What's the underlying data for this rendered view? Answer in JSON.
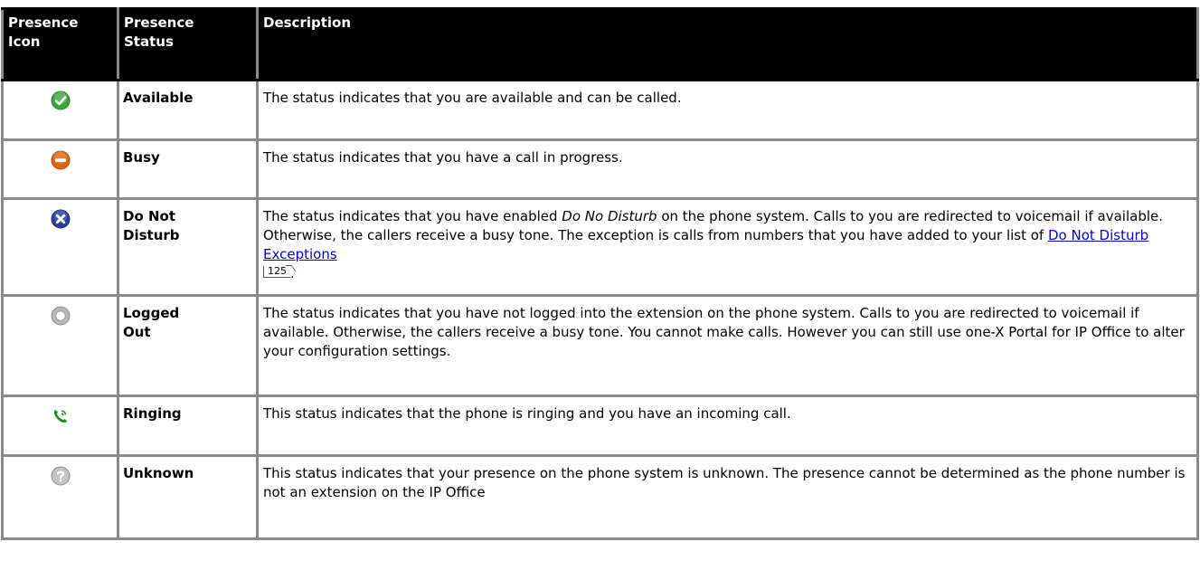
{
  "table": {
    "headers": {
      "icon": [
        "Presence",
        "Icon"
      ],
      "status": [
        "Presence",
        "Status"
      ],
      "description": "Description"
    },
    "rows": [
      {
        "icon": "check-circle-icon",
        "icon_color": "#3aa635",
        "status": "Available",
        "description": "The status indicates that you are available and can be called."
      },
      {
        "icon": "minus-circle-icon",
        "icon_color": "#e0640f",
        "status": "Busy",
        "description": "The status indicates that you have a call in progress."
      },
      {
        "icon": "x-circle-icon",
        "icon_color": "#2a3fa0",
        "status_lines": [
          "Do Not",
          "Disturb"
        ],
        "description_parts": {
          "before_italic": "The status indicates that you have enabled ",
          "italic": "Do No Disturb",
          "after_italic": " on the phone system. Calls to you are redirected to voicemail if available. Otherwise, the callers receive a busy tone. The exception is calls from numbers that you have added to your list of ",
          "link": "Do Not Disturb Exceptions",
          "page_ref": "125",
          "end": "."
        }
      },
      {
        "icon": "empty-circle-icon",
        "icon_color": "#9a9a9a",
        "status_lines": [
          "Logged",
          "Out"
        ],
        "description": "The status indicates that you have not logged into the extension on the phone system. Calls to you are redirected to voicemail if available. Otherwise, the callers receive a busy tone. You cannot make calls. However you can still use one-X Portal for IP Office to alter your configuration settings."
      },
      {
        "icon": "phone-ringing-icon",
        "icon_color": "#1e8a2c",
        "status": "Ringing",
        "description": "This status indicates that the phone is ringing and you have an incoming call."
      },
      {
        "icon": "question-circle-icon",
        "icon_color": "#8c8c8c",
        "status": "Unknown",
        "description": "This status indicates that your presence on the phone system is unknown. The presence cannot be determined as the phone number is not an extension on the IP Office"
      }
    ]
  }
}
